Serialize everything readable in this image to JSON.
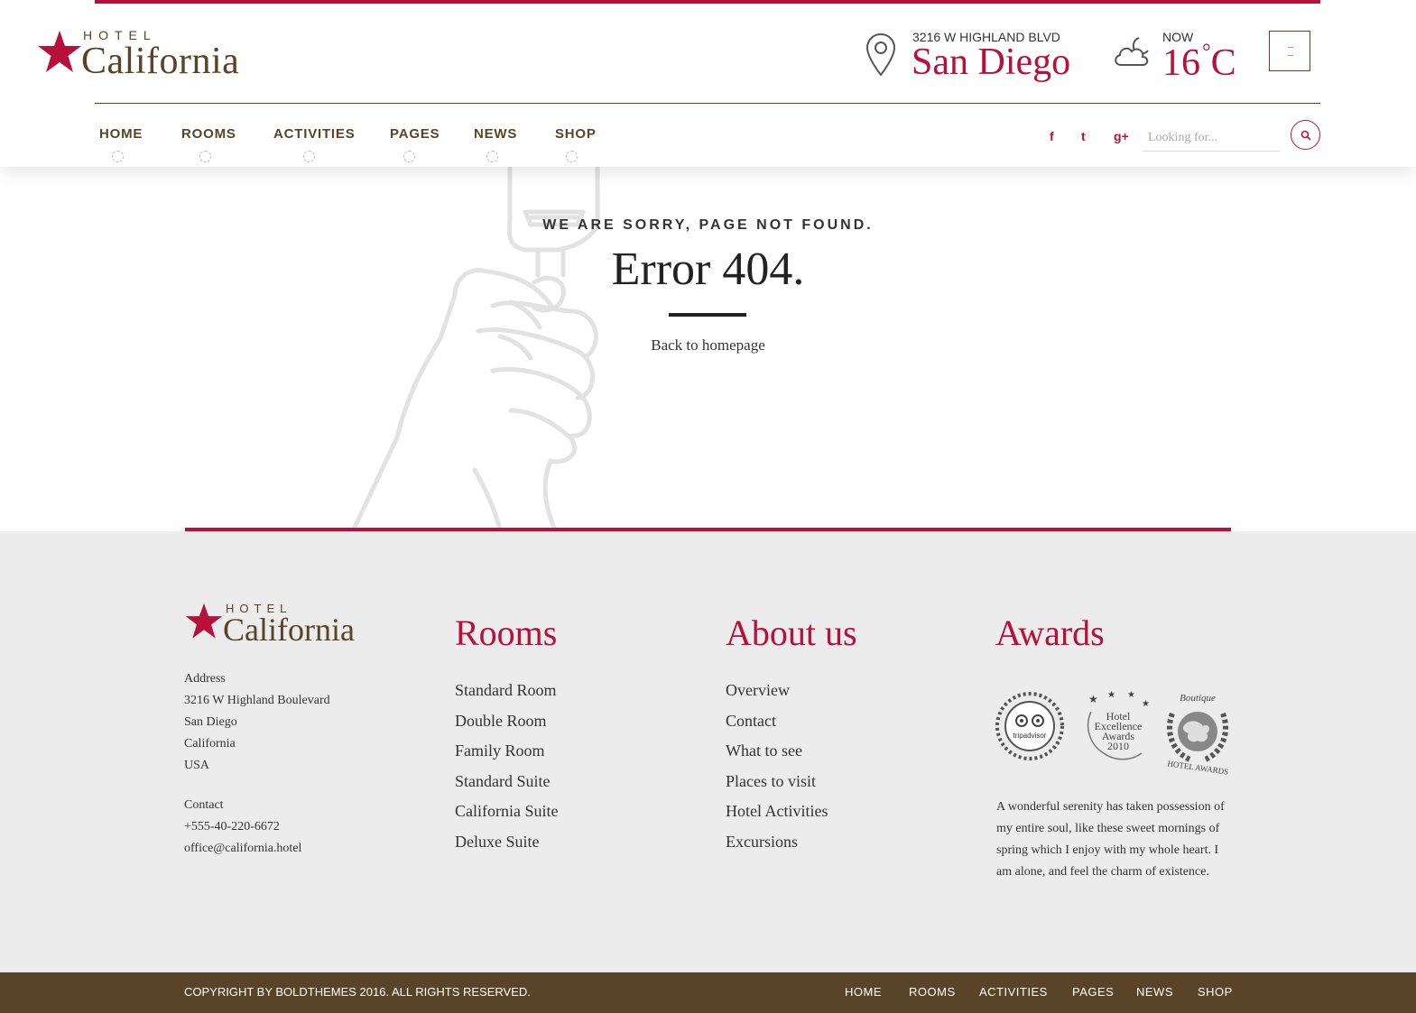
{
  "brand": {
    "hotel": "HOTEL",
    "name": "California",
    "accent_color": "#b8103a",
    "brown_color": "#5a4428"
  },
  "header": {
    "location_small": "3216 W HIGHLAND BLVD",
    "location_big": "San Diego",
    "weather_small": "NOW",
    "temperature": "16",
    "temperature_unit": "C",
    "search_placeholder": "Looking for...",
    "nav": [
      {
        "label": "HOME"
      },
      {
        "label": "ROOMS"
      },
      {
        "label": "ACTIVITIES"
      },
      {
        "label": "PAGES"
      },
      {
        "label": "NEWS"
      },
      {
        "label": "SHOP"
      }
    ],
    "social": [
      {
        "icon": "facebook-icon",
        "glyph": "f"
      },
      {
        "icon": "twitter-icon",
        "glyph": "t"
      },
      {
        "icon": "google-plus-icon",
        "glyph": "g+"
      }
    ]
  },
  "error": {
    "sorry": "WE ARE SORRY, PAGE NOT FOUND.",
    "title": "Error 404.",
    "back_link": "Back to homepage"
  },
  "footer": {
    "address_label": "Address",
    "address_line1": "3216 W Highland Boulevard",
    "address_line2": "San Diego",
    "address_line3": "California",
    "address_line4": "USA",
    "contact_label": "Contact",
    "phone": "+555-40-220-6672",
    "email": "office@california.hotel",
    "rooms_title": "Rooms",
    "rooms": [
      "Standard Room",
      "Double Room",
      "Family Room",
      "Standard Suite",
      "California Suite",
      "Deluxe Suite"
    ],
    "about_title": "About us",
    "about": [
      "Overview",
      "Contact",
      "What to see",
      "Places to visit",
      "Hotel Activities",
      "Excursions"
    ],
    "awards_title": "Awards",
    "award_tripadvisor": "tripadvisor",
    "award_excellence_1": "Hotel",
    "award_excellence_2": "Excellence",
    "award_excellence_3": "Awards",
    "award_excellence_4": "2010",
    "award_boutique_1": "Boutique",
    "award_boutique_2": "HOTEL AWARDS",
    "award_text": "A wonderful serenity has taken possession of my entire soul, like these sweet mornings of spring which I enjoy with my whole heart. I am alone, and feel the charm of existence."
  },
  "bottom": {
    "copyright": "COPYRIGHT BY BOLDTHEMES 2016. ALL RIGHTS RESERVED.",
    "nav": [
      "HOME",
      "ROOMS",
      "ACTIVITIES",
      "PAGES",
      "NEWS",
      "SHOP"
    ]
  }
}
